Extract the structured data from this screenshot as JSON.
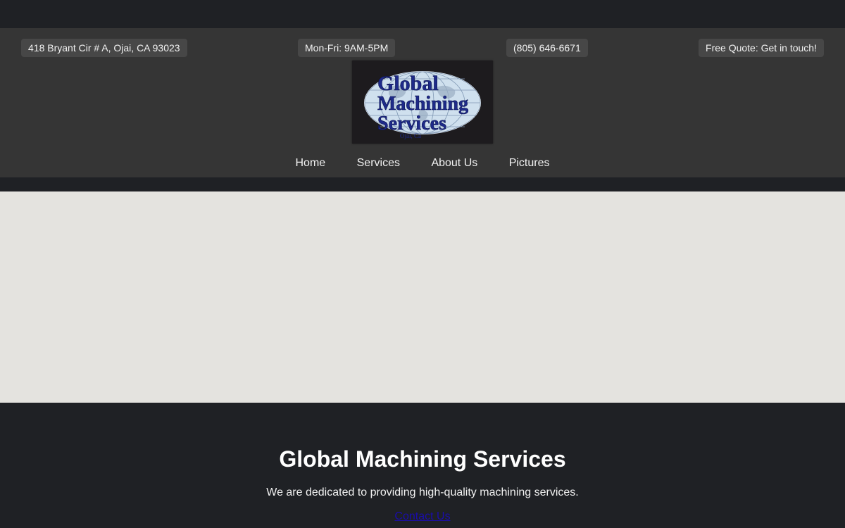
{
  "info_bar": {
    "address": "418 Bryant Cir # A, Ojai, CA 93023",
    "hours": "Mon-Fri: 9AM-5PM",
    "phone": "(805) 646-6671",
    "quote": "Free Quote: Get in touch!"
  },
  "logo": {
    "line1": "Global",
    "line2": "Machining",
    "line3": "Services",
    "small": "Ojai, Ca",
    "text_color": "#1e2a8a",
    "globe_color": "#cfe0ee"
  },
  "nav": {
    "items": [
      {
        "label": "Home"
      },
      {
        "label": "Services"
      },
      {
        "label": "About Us"
      },
      {
        "label": "Pictures"
      }
    ]
  },
  "footer": {
    "title": "Global Machining Services",
    "tagline": "We are dedicated to providing high-quality machining services.",
    "contact_link": "Contact Us"
  },
  "colors": {
    "page_bg": "#1f2125",
    "header_bg": "#353535",
    "pill_bg": "#474747",
    "hero_bg": "#e4e3df",
    "link": "#1a0dab"
  }
}
